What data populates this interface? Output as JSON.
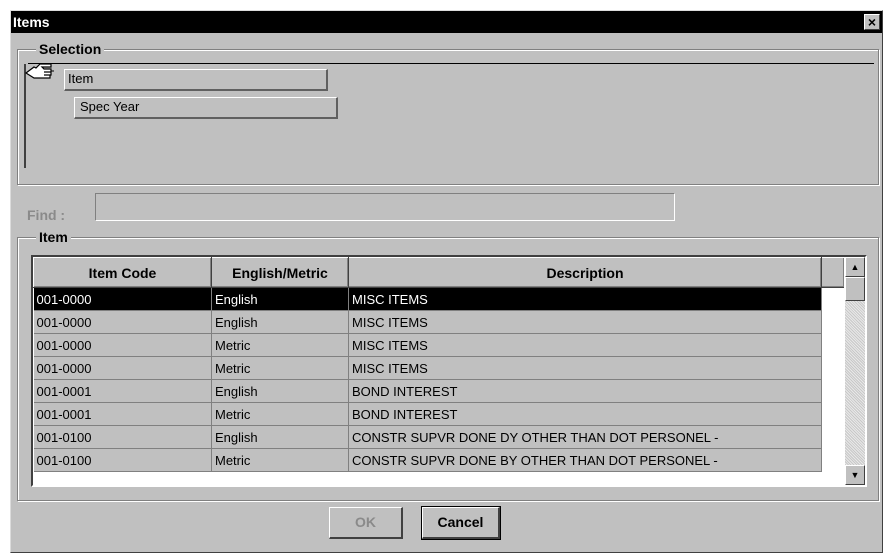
{
  "window": {
    "title": "Items",
    "close_glyph": "×"
  },
  "selection": {
    "legend": "Selection",
    "pointer_icon": "pointing-hand-icon",
    "buttons": [
      {
        "label": "Item"
      },
      {
        "label": "Spec Year"
      }
    ]
  },
  "find": {
    "label": "Find :",
    "value": "",
    "placeholder": ""
  },
  "item_group": {
    "legend": "Item",
    "columns": [
      "Item Code",
      "English/Metric",
      "Description"
    ],
    "rows": [
      {
        "code": "001-0000",
        "unit": "English",
        "desc": "MISC ITEMS",
        "selected": true
      },
      {
        "code": "001-0000",
        "unit": "English",
        "desc": "MISC ITEMS",
        "selected": false
      },
      {
        "code": "001-0000",
        "unit": "Metric",
        "desc": "MISC ITEMS",
        "selected": false
      },
      {
        "code": "001-0000",
        "unit": "Metric",
        "desc": "MISC ITEMS",
        "selected": false
      },
      {
        "code": "001-0001",
        "unit": "English",
        "desc": "BOND INTEREST",
        "selected": false
      },
      {
        "code": "001-0001",
        "unit": "Metric",
        "desc": "BOND INTEREST",
        "selected": false
      },
      {
        "code": "001-0100",
        "unit": "English",
        "desc": "CONSTR SUPVR DONE DY OTHER THAN DOT PERSONEL -",
        "selected": false
      },
      {
        "code": "001-0100",
        "unit": "Metric",
        "desc": "CONSTR SUPVR DONE BY OTHER THAN DOT PERSONEL -",
        "selected": false
      }
    ]
  },
  "scrollbar": {
    "up_glyph": "▲",
    "down_glyph": "▼"
  },
  "buttons": {
    "ok": "OK",
    "cancel": "Cancel"
  },
  "colors": {
    "selected_row": "#000000",
    "dialog_bg": "#c0c0c0"
  }
}
